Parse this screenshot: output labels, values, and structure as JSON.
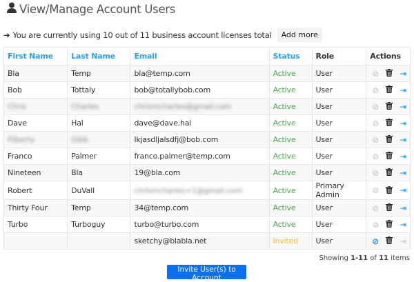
{
  "header": {
    "title": "View/Manage Account Users",
    "icon": "user-icon"
  },
  "license": {
    "text": "You are currently using 10 out of 11 business account licenses total",
    "add_more": "Add more"
  },
  "table": {
    "columns": [
      "First Name",
      "Last Name",
      "Email",
      "Status",
      "Role",
      "Actions"
    ],
    "rows": [
      {
        "first": "Bla",
        "last": "Temp",
        "email": "bla@temp.com",
        "status": "Active",
        "role": "User"
      },
      {
        "first": "Bob",
        "last": "Tottaly",
        "email": "bob@totallybob.com",
        "status": "Active",
        "role": "User"
      },
      {
        "first": "Chris",
        "last": "Charles",
        "email": "chrismcharles@gmail.com",
        "status": "Active",
        "role": "User",
        "blur": [
          1,
          1,
          1
        ]
      },
      {
        "first": "Dave",
        "last": "Hal",
        "email": "dave@dave.hal",
        "status": "Active",
        "role": "User"
      },
      {
        "first": "Filberty",
        "last": "Gibb",
        "email": "lkjasdljalsdfj@bob.com",
        "status": "Active",
        "role": "User",
        "blur": [
          1,
          1,
          0
        ]
      },
      {
        "first": "Franco",
        "last": "Palmer",
        "email": "franco.palmer@temp.com",
        "status": "Active",
        "role": "User"
      },
      {
        "first": "Nineteen",
        "last": "Bla",
        "email": "19@bla.com",
        "status": "Active",
        "role": "User"
      },
      {
        "first": "Robert",
        "last": "DuVall",
        "email": "chrismcharles+1@gmail.com",
        "status": "Active",
        "role": "Primary Admin",
        "blur": [
          0,
          0,
          1
        ]
      },
      {
        "first": "Thirty Four",
        "last": "Temp",
        "email": "34@temp.com",
        "status": "Active",
        "role": "User"
      },
      {
        "first": "Turbo",
        "last": "Turboguy",
        "email": "turbo@turbo.com",
        "status": "Active",
        "role": "User"
      },
      {
        "first": "",
        "last": "",
        "email": "sketchy@blabla.net",
        "status": "Invited",
        "role": "User"
      }
    ]
  },
  "colors": {
    "active": "#4aa84a",
    "invited": "#f2c030",
    "header_link": "#2aa0f0",
    "button": "#0a6ff0"
  },
  "footer": {
    "showing_prefix": "Showing ",
    "range": "1-11",
    "of": " of ",
    "total": "11",
    "suffix": " items"
  },
  "invite_button": "Invite User(s) to Account"
}
